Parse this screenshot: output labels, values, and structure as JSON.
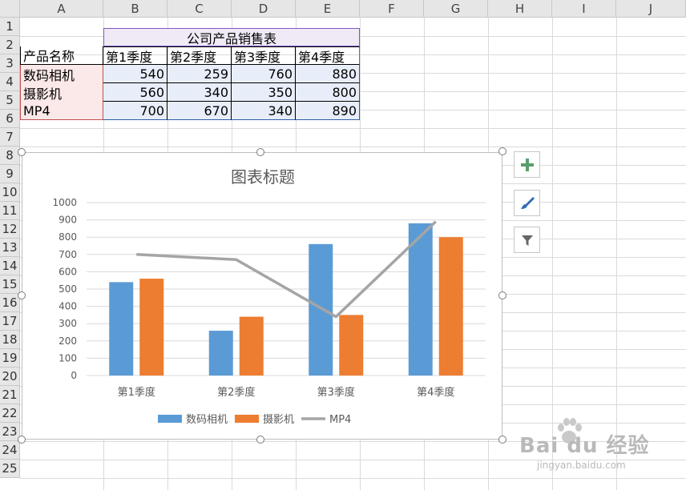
{
  "columns": [
    "A",
    "B",
    "C",
    "D",
    "E",
    "F",
    "G",
    "H",
    "I",
    "J"
  ],
  "rows": [
    "1",
    "2",
    "3",
    "4",
    "5",
    "6",
    "7",
    "8",
    "9",
    "10",
    "11",
    "12",
    "13",
    "14",
    "15",
    "16",
    "17",
    "18",
    "19",
    "20",
    "21",
    "22",
    "23",
    "24",
    "25"
  ],
  "table": {
    "title": "公司产品销售表",
    "header": [
      "产品名称",
      "第1季度",
      "第2季度",
      "第3季度",
      "第4季度"
    ],
    "data": [
      {
        "name": "数码相机",
        "values": [
          "540",
          "259",
          "760",
          "880"
        ]
      },
      {
        "name": "摄影机",
        "values": [
          "560",
          "340",
          "350",
          "800"
        ]
      },
      {
        "name": "MP4",
        "values": [
          "700",
          "670",
          "340",
          "890"
        ]
      }
    ]
  },
  "chart_data": {
    "type": "bar",
    "title": "图表标题",
    "categories": [
      "第1季度",
      "第2季度",
      "第3季度",
      "第4季度"
    ],
    "series": [
      {
        "name": "数码相机",
        "type": "bar",
        "color": "#5b9bd5",
        "values": [
          540,
          259,
          760,
          880
        ]
      },
      {
        "name": "摄影机",
        "type": "bar",
        "color": "#ed7d31",
        "values": [
          560,
          340,
          350,
          800
        ]
      },
      {
        "name": "MP4",
        "type": "line",
        "color": "#a5a5a5",
        "values": [
          700,
          670,
          340,
          890
        ]
      }
    ],
    "ylim": [
      0,
      1000
    ],
    "yticks": [
      "0",
      "100",
      "200",
      "300",
      "400",
      "500",
      "600",
      "700",
      "800",
      "900",
      "1000"
    ],
    "grid": true,
    "legend": "bottom"
  },
  "chart_tools": {
    "add_icon": "plus-icon",
    "style_icon": "brush-icon",
    "filter_icon": "filter-icon"
  },
  "watermark": {
    "brand": "Bai du 经验",
    "url": "jingyan.baidu.com"
  }
}
